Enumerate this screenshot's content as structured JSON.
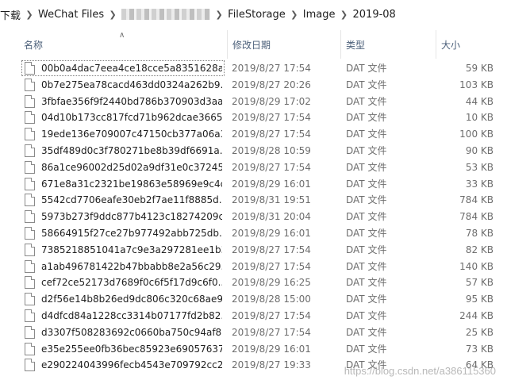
{
  "breadcrumb": {
    "items": [
      "下载",
      "WeChat Files",
      "FileStorage",
      "Image",
      "2019-08"
    ]
  },
  "columns": {
    "name": "名称",
    "modified": "修改日期",
    "type": "类型",
    "size": "大小"
  },
  "files": [
    {
      "name": "00b0a4dac7eea4ce18cce5a8351628a...",
      "modified": "2019/8/27 17:54",
      "type": "DAT 文件",
      "size": "59 KB"
    },
    {
      "name": "0b7e275ea78cacd463dd0324a262b9...",
      "modified": "2019/8/27 20:26",
      "type": "DAT 文件",
      "size": "103 KB"
    },
    {
      "name": "3fbfae356f9f2440bd786b370903d3aa...",
      "modified": "2019/8/29 17:02",
      "type": "DAT 文件",
      "size": "44 KB"
    },
    {
      "name": "04d10b173cc817fcd71b962dcae3665...",
      "modified": "2019/8/27 17:54",
      "type": "DAT 文件",
      "size": "10 KB"
    },
    {
      "name": "19ede136e709007c47150cb377a06a3...",
      "modified": "2019/8/27 17:54",
      "type": "DAT 文件",
      "size": "100 KB"
    },
    {
      "name": "35df489d0c3f780271be8b39df6691a...",
      "modified": "2019/8/28 10:59",
      "type": "DAT 文件",
      "size": "90 KB"
    },
    {
      "name": "86a1ce96002d25d02a9df31e0c37245...",
      "modified": "2019/8/27 17:54",
      "type": "DAT 文件",
      "size": "53 KB"
    },
    {
      "name": "671e8a31c2321be19863e58969e9c4c...",
      "modified": "2019/8/29 16:01",
      "type": "DAT 文件",
      "size": "33 KB"
    },
    {
      "name": "5542cd7706eafe30eb2f7ae11f8885d...",
      "modified": "2019/8/31 19:51",
      "type": "DAT 文件",
      "size": "784 KB"
    },
    {
      "name": "5973b273f9ddc877b4123c18274209c...",
      "modified": "2019/8/31 20:04",
      "type": "DAT 文件",
      "size": "784 KB"
    },
    {
      "name": "58664915f27ce27b977492abb725db...",
      "modified": "2019/8/29 16:01",
      "type": "DAT 文件",
      "size": "78 KB"
    },
    {
      "name": "7385218851041a7c9e3a297281ee1b3...",
      "modified": "2019/8/27 17:54",
      "type": "DAT 文件",
      "size": "82 KB"
    },
    {
      "name": "a1ab496781422b47bbabb8e2a56c29...",
      "modified": "2019/8/27 17:54",
      "type": "DAT 文件",
      "size": "140 KB"
    },
    {
      "name": "cef72ce52173d7689f0c6f5f17d9c6f0...",
      "modified": "2019/8/29 16:25",
      "type": "DAT 文件",
      "size": "57 KB"
    },
    {
      "name": "d2f56e14b8b26ed9dc806c320c68ae9...",
      "modified": "2019/8/28 15:00",
      "type": "DAT 文件",
      "size": "95 KB"
    },
    {
      "name": "d4dfcd84a1228cc3314b07177fd2b82...",
      "modified": "2019/8/27 17:54",
      "type": "DAT 文件",
      "size": "244 KB"
    },
    {
      "name": "d3307f508283692c0660ba750c94af8...",
      "modified": "2019/8/27 17:54",
      "type": "DAT 文件",
      "size": "25 KB"
    },
    {
      "name": "e35e255ee0fb36bec85923e69057637...",
      "modified": "2019/8/29 16:01",
      "type": "DAT 文件",
      "size": "73 KB"
    },
    {
      "name": "e290224043996fecb4543e709792cc2...",
      "modified": "2019/8/27 19:33",
      "type": "DAT 文件",
      "size": "64 KB"
    }
  ],
  "watermark": "https://blog.csdn.net/a386115360"
}
